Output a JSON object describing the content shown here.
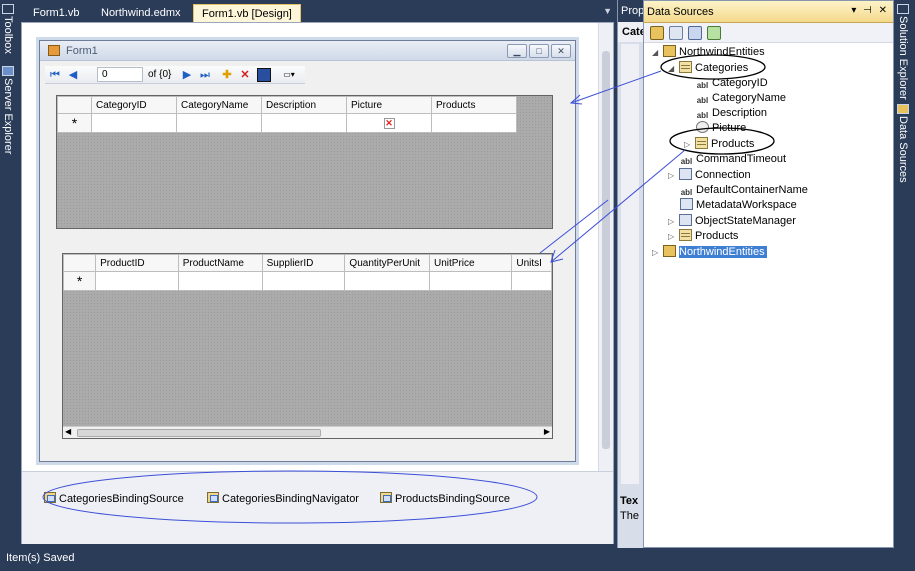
{
  "left_strip": {
    "toolbox": "Toolbox",
    "server_explorer": "Server Explorer"
  },
  "doc_tabs": [
    {
      "label": "Form1.vb"
    },
    {
      "label": "Northwind.edmx"
    },
    {
      "label": "Form1.vb [Design]",
      "active": true
    }
  ],
  "form": {
    "title": "Form1",
    "navigator": {
      "position": "0",
      "count": "of {0}"
    },
    "grid_categories": {
      "columns": [
        "CategoryID",
        "CategoryName",
        "Description",
        "Picture",
        "Products"
      ],
      "new_row_marker": "*"
    },
    "grid_products": {
      "columns": [
        "ProductID",
        "ProductName",
        "SupplierID",
        "QuantityPerUnit",
        "UnitPrice",
        "UnitsI"
      ],
      "new_row_marker": "*"
    }
  },
  "tray": {
    "items": [
      "CategoriesBindingSource",
      "CategoriesBindingNavigator",
      "ProductsBindingSource"
    ]
  },
  "properties": {
    "title": "Prop",
    "subtitle": "Cate",
    "desc_title": "Tex",
    "desc_text": "The"
  },
  "data_sources": {
    "title": "Data Sources",
    "title_controls": "▾ ⊣ ✕",
    "tree": [
      "NorthwindEntities",
      "Categories",
      "CategoryID",
      "CategoryName",
      "Description",
      "Picture",
      "Products",
      "CommandTimeout",
      "Connection",
      "DefaultContainerName",
      "MetadataWorkspace",
      "ObjectStateManager",
      "Products",
      "NorthwindEntities"
    ]
  },
  "right_strip": {
    "solution_explorer": "Solution Explorer",
    "data_sources": "Data Sources"
  },
  "status": "Item(s) Saved",
  "colors": {
    "chrome": "#2b3c59",
    "selection": "#3e7fd4",
    "annotation": "#3c4fd8"
  }
}
